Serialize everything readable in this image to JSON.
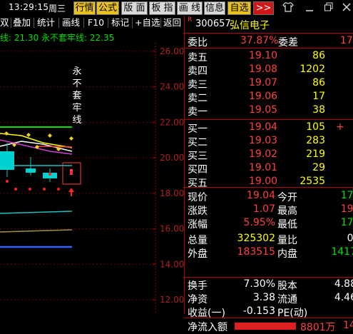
{
  "topbar": {
    "time": "13:29:15",
    "weekday": "周三",
    "buttons": [
      "行情",
      "公式",
      "版 面",
      "板 指",
      "画 线",
      "信息",
      "自选",
      ">>"
    ]
  },
  "toolbar2": {
    "items": [
      "双",
      "叠加",
      "统计",
      "画线",
      "F10",
      "标记",
      "+自选",
      "返回"
    ],
    "ma_line": "线: 21.30 永不套牢线: 22.35",
    "vertical_label": "永不套牢线"
  },
  "chart_data": {
    "type": "line",
    "y_ticks": [
      "26.00",
      "24.00",
      "22.00",
      "20.00",
      "18.00",
      "16.00",
      "14.00",
      "12.00"
    ],
    "y_values": [
      26,
      24,
      22,
      20,
      18,
      16,
      14,
      12
    ],
    "ylim": [
      11.2,
      27.2
    ],
    "lines": [
      {
        "name": "永不套牢线",
        "value": 22.35
      },
      {
        "name": "线",
        "value": 21.3
      }
    ]
  },
  "stock": {
    "marker": "R",
    "code": "300657",
    "name": "弘信电子"
  },
  "weibi": {
    "label": "委比",
    "value": "37.87%",
    "label2": "委差",
    "value2": "17"
  },
  "asks": [
    {
      "label": "卖五",
      "price": "19.10",
      "vol": "86"
    },
    {
      "label": "卖四",
      "price": "19.08",
      "vol": "1202"
    },
    {
      "label": "卖三",
      "price": "19.07",
      "vol": "86"
    },
    {
      "label": "卖二",
      "price": "19.06",
      "vol": "17"
    },
    {
      "label": "卖一",
      "price": "19.05",
      "vol": "38"
    }
  ],
  "bids": [
    {
      "label": "买一",
      "price": "19.04",
      "vol": "105",
      "extra": "+"
    },
    {
      "label": "买二",
      "price": "19.03",
      "vol": "283",
      "extra": ""
    },
    {
      "label": "买三",
      "price": "19.02",
      "vol": "219",
      "extra": ""
    },
    {
      "label": "买四",
      "price": "19.01",
      "vol": "29",
      "extra": ""
    },
    {
      "label": "买五",
      "price": "19.00",
      "vol": "2535",
      "extra": ""
    }
  ],
  "quote": [
    {
      "l1": "现价",
      "v1": "19.04",
      "l2": "今开",
      "v2": "17."
    },
    {
      "l1": "涨跌",
      "v1": "1.07",
      "l2": "最高",
      "v2": "19."
    },
    {
      "l1": "涨幅",
      "v1": "5.95%",
      "l2": "最低",
      "v2": "17."
    },
    {
      "l1": "总量",
      "v1": "325302",
      "l2": "量比",
      "v2": "0."
    },
    {
      "l1": "外盘",
      "v1": "183515",
      "l2": "内盘",
      "v2": "1417"
    }
  ],
  "fin": [
    {
      "l1": "换手",
      "v1": "7.30%",
      "l2": "股本",
      "v2": "4.88"
    },
    {
      "l1": "净资",
      "v1": "3.38",
      "l2": "流通",
      "v2": "4.46"
    },
    {
      "l1": "收益(一)",
      "v1": "-0.153",
      "l2": "PE(动)",
      "v2": ""
    }
  ],
  "netflow": {
    "label": "净流入额",
    "value": "8801万",
    "extra": "14"
  },
  "colors": {
    "up": "#ff4040",
    "down": "#00e000",
    "gold": "#e8c020",
    "border": "#b00000",
    "yellow": "#ffff00"
  }
}
